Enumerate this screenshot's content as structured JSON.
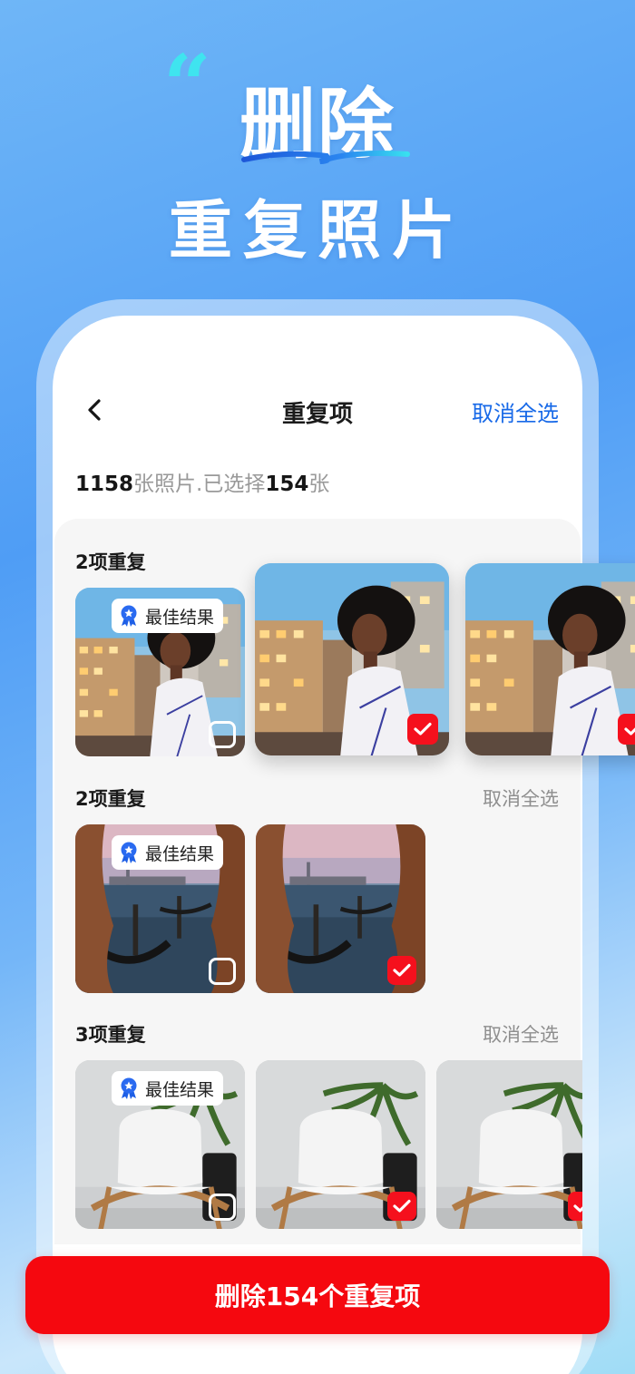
{
  "headline": {
    "quote_mark": "“",
    "title": "删除",
    "subtitle": "重复照片"
  },
  "nav": {
    "back_icon": "chevron-left-icon",
    "title": "重复项",
    "deselect_all": "取消全选"
  },
  "summary": {
    "count_total": "1158",
    "text_mid": "张照片.已选择",
    "count_selected": "154",
    "text_end": "张"
  },
  "badge": {
    "label": "最佳结果",
    "icon": "award-ribbon-icon"
  },
  "groups": [
    {
      "title": "2项重复",
      "action": "",
      "photos": [
        {
          "scene": "woman-city",
          "best": true,
          "selected": false
        },
        {
          "scene": "woman-city",
          "best": false,
          "selected": true
        },
        {
          "scene": "woman-city",
          "best": false,
          "selected": true
        }
      ]
    },
    {
      "title": "2项重复",
      "action": "取消全选",
      "photos": [
        {
          "scene": "venice-gondola",
          "best": true,
          "selected": false
        },
        {
          "scene": "venice-gondola",
          "best": false,
          "selected": true
        }
      ]
    },
    {
      "title": "3项重复",
      "action": "取消全选",
      "photos": [
        {
          "scene": "white-chair-palm",
          "best": true,
          "selected": false
        },
        {
          "scene": "white-chair-palm",
          "best": false,
          "selected": true
        },
        {
          "scene": "white-chair-palm",
          "best": false,
          "selected": true
        }
      ]
    }
  ],
  "delete_button": "删除154个重复项",
  "colors": {
    "accent_blue": "#1769e8",
    "delete_red": "#f5080f",
    "check_red": "#f5101d",
    "quote_cyan": "#3fe4ef"
  }
}
